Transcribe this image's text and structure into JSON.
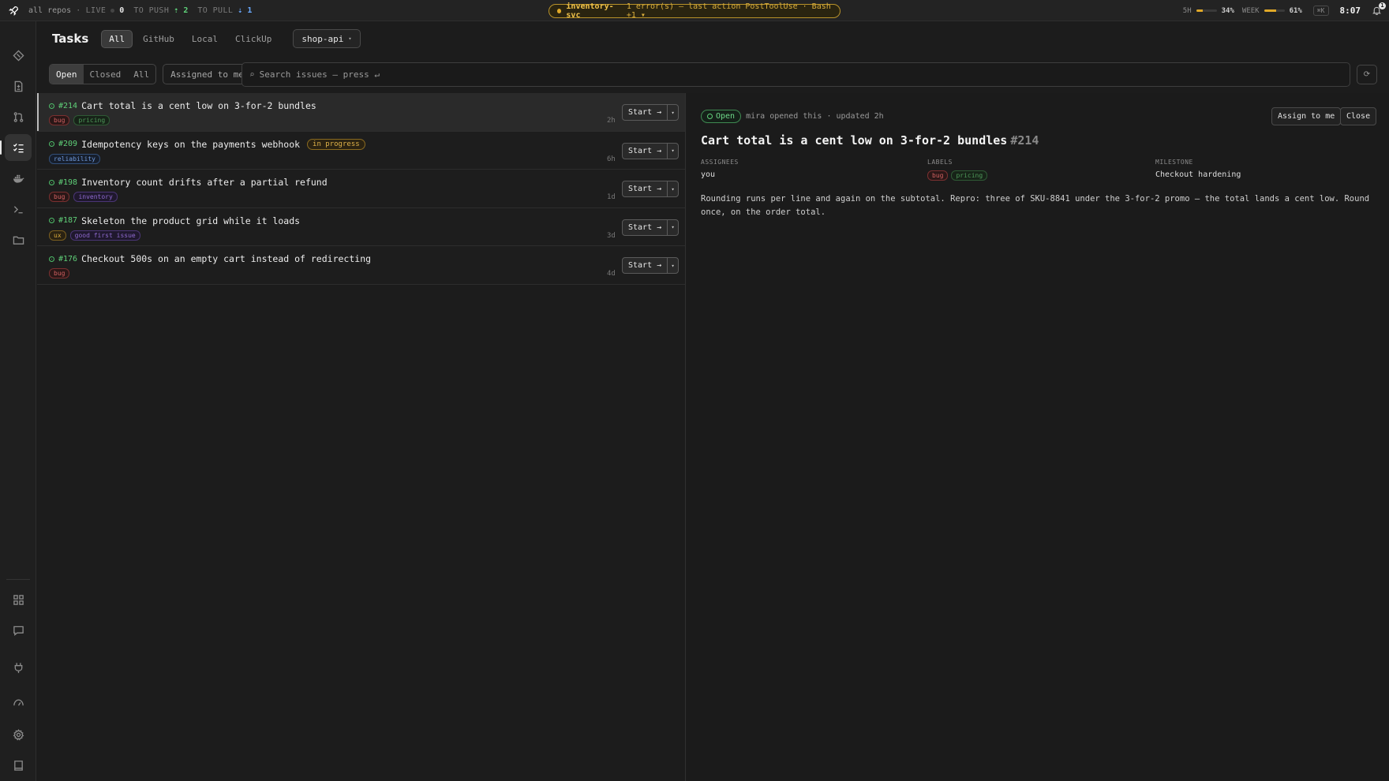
{
  "topbar": {
    "scope": "all repos",
    "live_label": "LIVE",
    "live_count": "0",
    "to_push_label": "TO PUSH",
    "to_push_count": "⇡ 2",
    "to_pull_label": "TO PULL",
    "to_pull_count": "⇣ 1",
    "alert": {
      "service": "inventory-svc",
      "message": "1 error(s) — last action PostToolUse · Bash +1 ▾"
    },
    "usage": {
      "five_hour_label": "5H",
      "five_hour_pct": "34%",
      "five_hour_fraction": 0.34,
      "week_label": "WEEK",
      "week_pct": "61%",
      "week_fraction": 0.61
    },
    "shortcut": "⌘K",
    "clock": "8:07",
    "notifications": "1"
  },
  "sidebar": {
    "items": [
      {
        "name": "sidebar-item-git",
        "icon": "diamond-icon"
      },
      {
        "name": "sidebar-item-files",
        "icon": "file-diff-icon"
      },
      {
        "name": "sidebar-item-pull-requests",
        "icon": "pull-request-icon"
      },
      {
        "name": "sidebar-item-tasks",
        "icon": "checklist-icon",
        "active": true
      },
      {
        "name": "sidebar-item-docker",
        "icon": "docker-whale-icon"
      },
      {
        "name": "sidebar-item-terminal",
        "icon": "terminal-icon"
      },
      {
        "name": "sidebar-item-folder",
        "icon": "folder-icon"
      },
      {
        "name": "sidebar-item-dashboard",
        "icon": "grid-icon"
      },
      {
        "name": "sidebar-item-chat",
        "icon": "chat-icon"
      },
      {
        "name": "sidebar-item-plugins",
        "icon": "plug-icon"
      },
      {
        "name": "sidebar-item-usage",
        "icon": "gauge-icon"
      },
      {
        "name": "sidebar-item-settings",
        "icon": "gear-icon"
      },
      {
        "name": "sidebar-item-docs",
        "icon": "book-icon"
      }
    ]
  },
  "header": {
    "title": "Tasks",
    "source_tabs": [
      "All",
      "GitHub",
      "Local",
      "ClickUp"
    ],
    "repo": "shop-api",
    "repo_caret": "▾"
  },
  "filters": {
    "state_tabs": [
      "Open",
      "Closed",
      "All"
    ],
    "assigned_label": "Assigned to me",
    "search_placeholder": "Search issues — press ↵",
    "refresh_icon": "⟳"
  },
  "issues": [
    {
      "number": "#214",
      "title": "Cart total is a cent low on 3-for-2 bundles",
      "labels": [
        {
          "text": "bug",
          "kind": "bug"
        },
        {
          "text": "pricing",
          "kind": "pricing"
        }
      ],
      "status": "",
      "age": "2h",
      "action": "Start →"
    },
    {
      "number": "#209",
      "title": "Idempotency keys on the payments webhook",
      "labels": [
        {
          "text": "reliability",
          "kind": "reliability"
        }
      ],
      "status": "in progress",
      "age": "6h",
      "action": "Start →"
    },
    {
      "number": "#198",
      "title": "Inventory count drifts after a partial refund",
      "labels": [
        {
          "text": "bug",
          "kind": "bug"
        },
        {
          "text": "inventory",
          "kind": "inventory"
        }
      ],
      "status": "",
      "age": "1d",
      "action": "Start →"
    },
    {
      "number": "#187",
      "title": "Skeleton the product grid while it loads",
      "labels": [
        {
          "text": "ux",
          "kind": "ux"
        },
        {
          "text": "good first issue",
          "kind": "gfi"
        }
      ],
      "status": "",
      "age": "3d",
      "action": "Start →"
    },
    {
      "number": "#176",
      "title": "Checkout 500s on an empty cart instead of redirecting",
      "labels": [
        {
          "text": "bug",
          "kind": "bug"
        }
      ],
      "status": "",
      "age": "4d",
      "action": "Start →"
    }
  ],
  "detail": {
    "state": "Open",
    "meta": "mira opened this · updated 2h",
    "assign_label": "Assign to me",
    "close_label": "Close",
    "title": "Cart total is a cent low on 3-for-2 bundles",
    "number": "#214",
    "assignees_label": "ASSIGNEES",
    "assignees": "you",
    "labels_label": "LABELS",
    "labels": [
      {
        "text": "bug",
        "kind": "bug"
      },
      {
        "text": "pricing",
        "kind": "pricing"
      }
    ],
    "milestone_label": "MILESTONE",
    "milestone": "Checkout hardening",
    "body": "Rounding runs per line and again on the subtotal. Repro: three of SKU-8841 under the 3-for-2 promo — the total lands a cent low. Round once, on the order total."
  },
  "colors": {
    "accent_green": "#5fcf78",
    "alert_amber": "#e0a928",
    "background": "#1c1c1c"
  }
}
